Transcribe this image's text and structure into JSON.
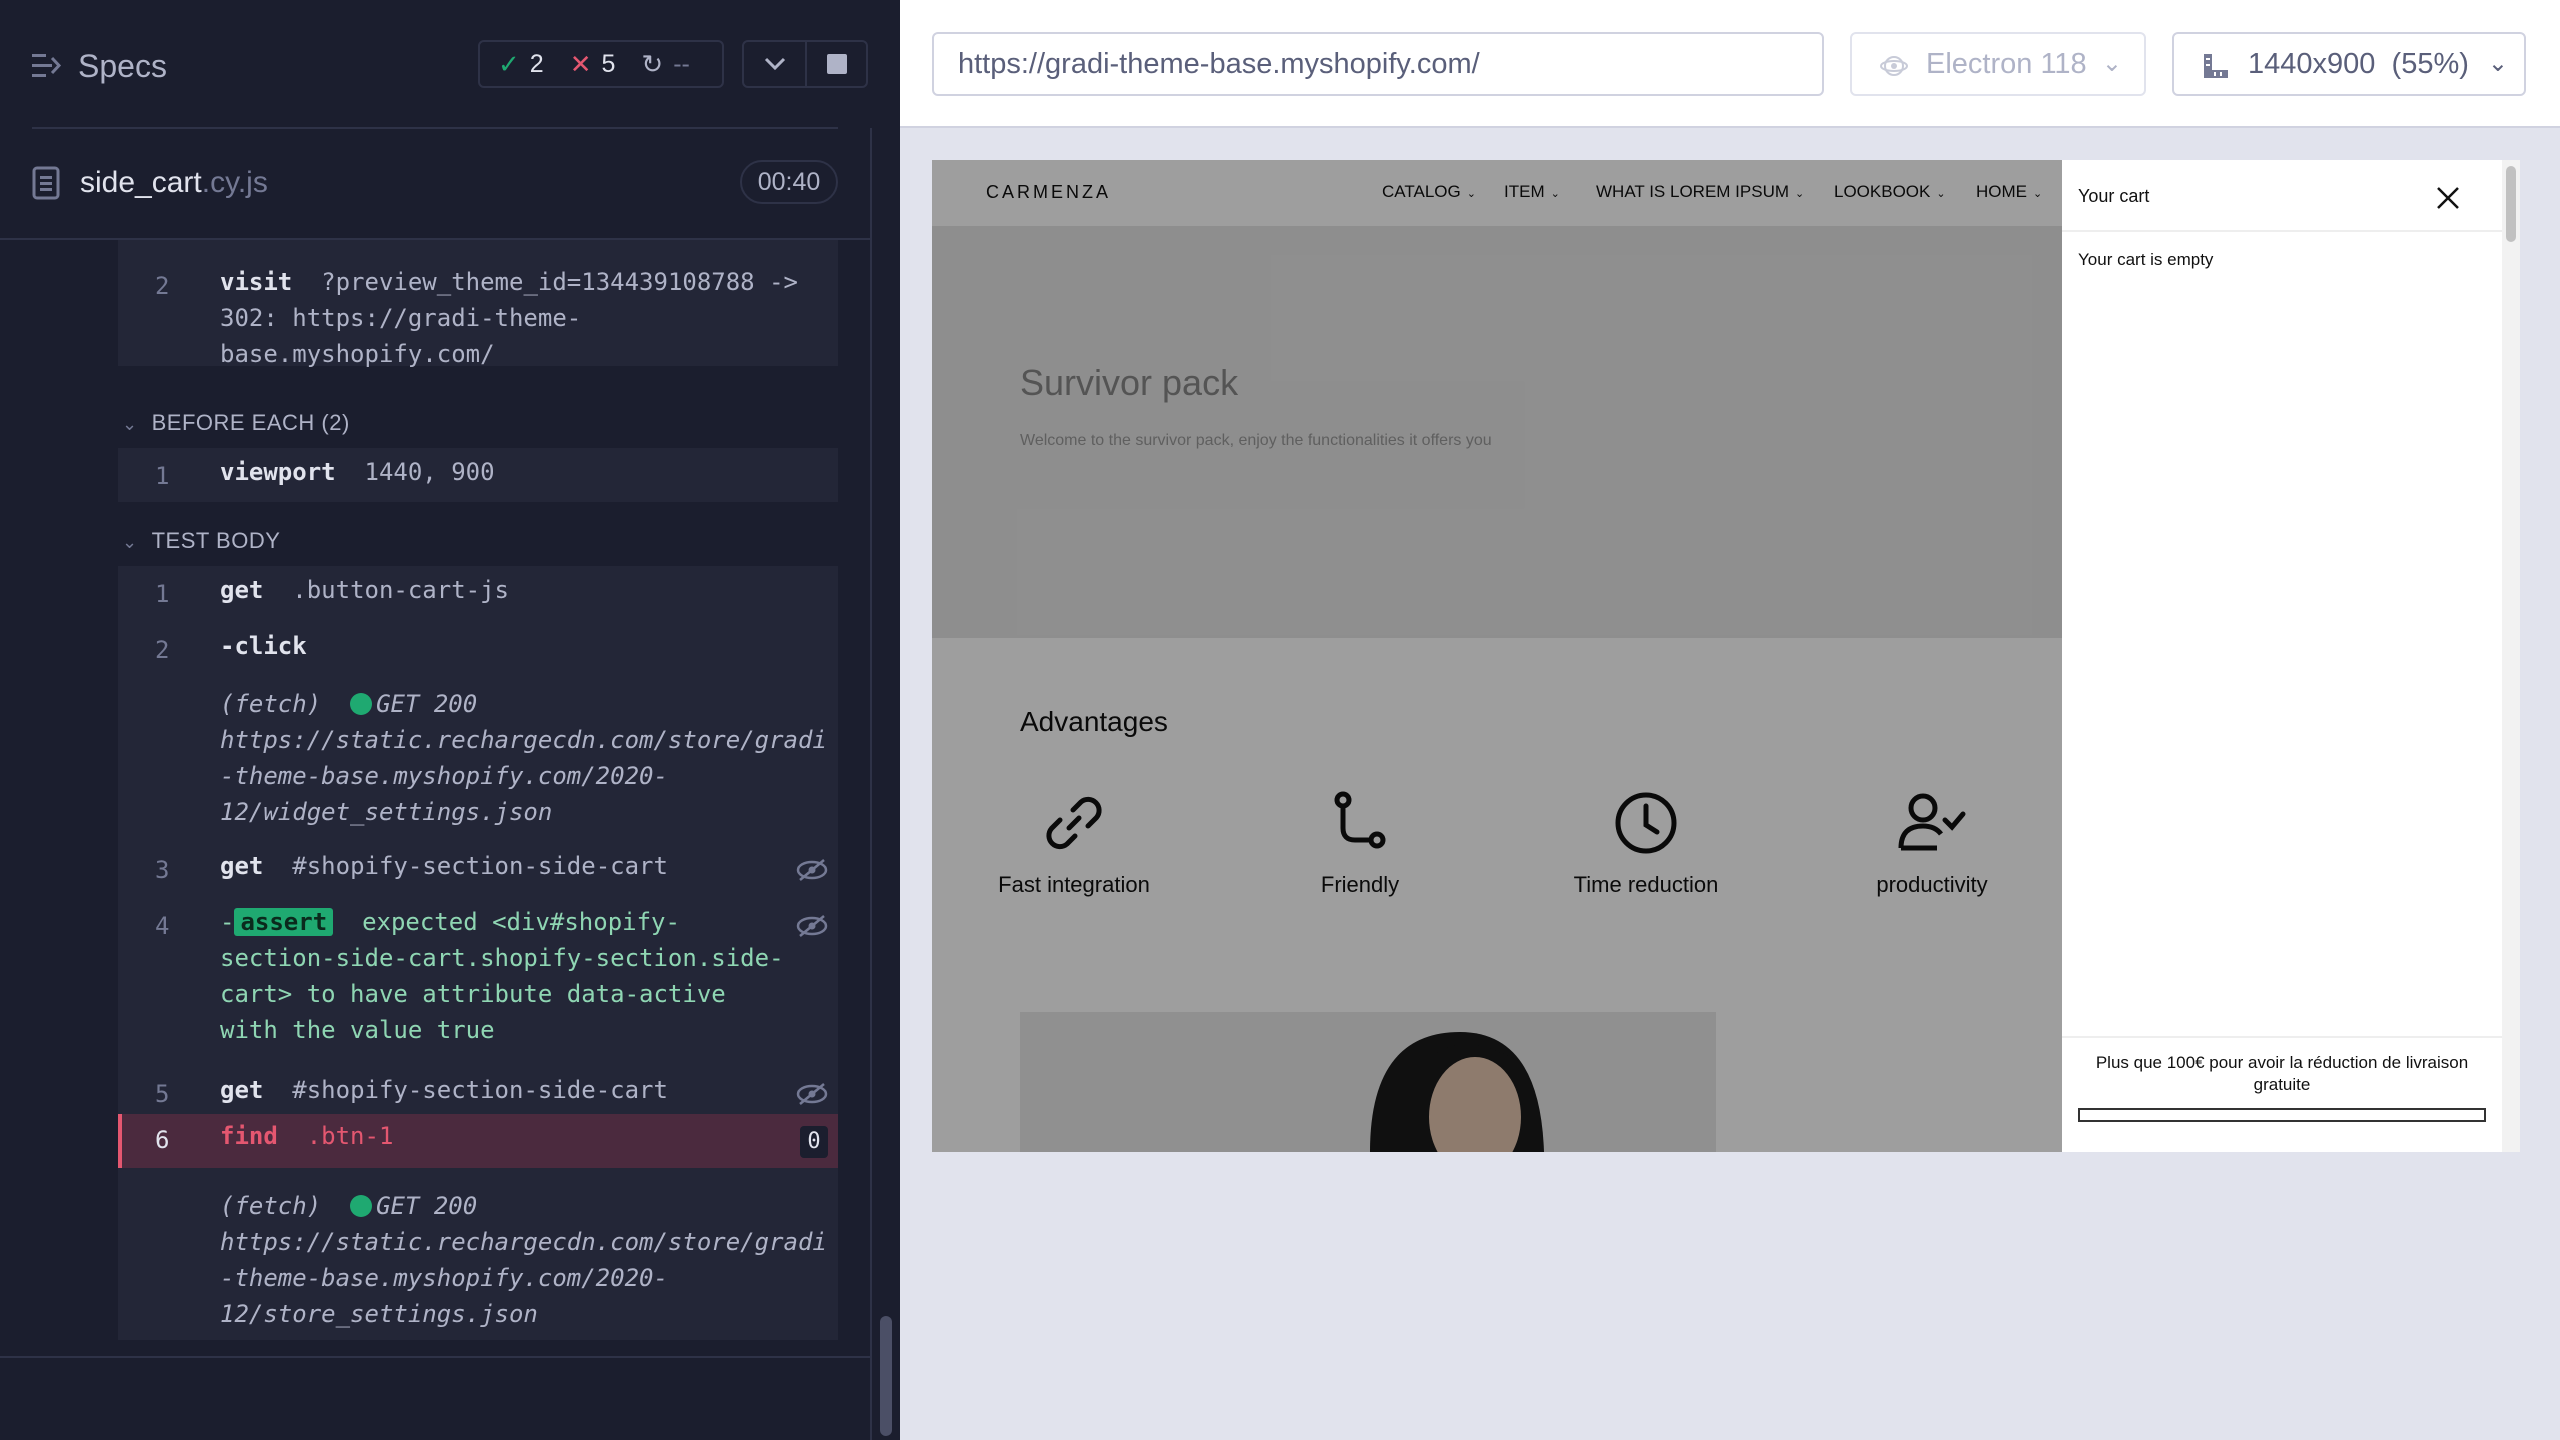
{
  "reporter": {
    "title": "Specs",
    "stats": {
      "passed": "2",
      "failed": "5",
      "pending": "--"
    },
    "spec": {
      "name": "side_cart",
      "ext": ".cy.js",
      "duration": "00:40"
    },
    "commands": {
      "visit": {
        "num": "2",
        "name": "visit",
        "lines": [
          "?preview_theme_id=134439108788 ->",
          "302: https://gradi-theme-",
          "base.myshopify.com/"
        ]
      },
      "before_each": {
        "label": "BEFORE EACH (2)"
      },
      "viewport": {
        "num": "1",
        "name": "viewport",
        "arg": "1440, 900"
      },
      "test_body": {
        "label": "TEST BODY"
      },
      "get1": {
        "num": "1",
        "name": "get",
        "arg": ".button-cart-js"
      },
      "click": {
        "num": "2",
        "name": "-click"
      },
      "fetch1": {
        "prefix": "(fetch)",
        "status": "GET 200",
        "lines": [
          "https://static.rechargecdn.com/store/gradi",
          "-theme-base.myshopify.com/2020-",
          "12/widget_settings.json"
        ]
      },
      "get2": {
        "num": "3",
        "name": "get",
        "arg": "#shopify-section-side-cart"
      },
      "assert": {
        "num": "4",
        "dash": "-",
        "badge": "assert",
        "lines": [
          "expected <div#shopify-",
          "section-side-cart.shopify-section.side-",
          "cart> to have attribute data-active",
          "with the value true"
        ]
      },
      "get3": {
        "num": "5",
        "name": "get",
        "arg": "#shopify-section-side-cart"
      },
      "find": {
        "num": "6",
        "name": "find",
        "arg": ".btn-1",
        "count": "0"
      },
      "fetch2": {
        "prefix": "(fetch)",
        "status": "GET 200",
        "lines": [
          "https://static.rechargecdn.com/store/gradi",
          "-theme-base.myshopify.com/2020-",
          "12/store_settings.json"
        ]
      }
    }
  },
  "aut": {
    "url": "https://gradi-theme-base.myshopify.com/",
    "browser": "Electron 118",
    "viewport": "1440x900",
    "scale": "(55%)"
  },
  "site": {
    "logo": "CARMENZA",
    "nav": [
      "CATALOG",
      "ITEM",
      "WHAT IS LOREM IPSUM",
      "LOOKBOOK",
      "HOME"
    ],
    "hero": {
      "title": "Survivor pack",
      "subtitle": "Welcome to the survivor pack, enjoy the functionalities it offers you"
    },
    "advantages": {
      "title": "Advantages",
      "items": [
        "Fast integration",
        "Friendly",
        "Time reduction",
        "productivity"
      ]
    },
    "cart": {
      "title": "Your cart",
      "empty": "Your cart is empty",
      "shipping": "Plus que 100€ pour avoir la réduction de livraison gratuite",
      "progress": 0
    }
  },
  "colors": {
    "pass": "#1fa971",
    "fail": "#e45770",
    "reporter_bg": "#1b1e2e",
    "aut_bg": "#e1e3ed"
  }
}
